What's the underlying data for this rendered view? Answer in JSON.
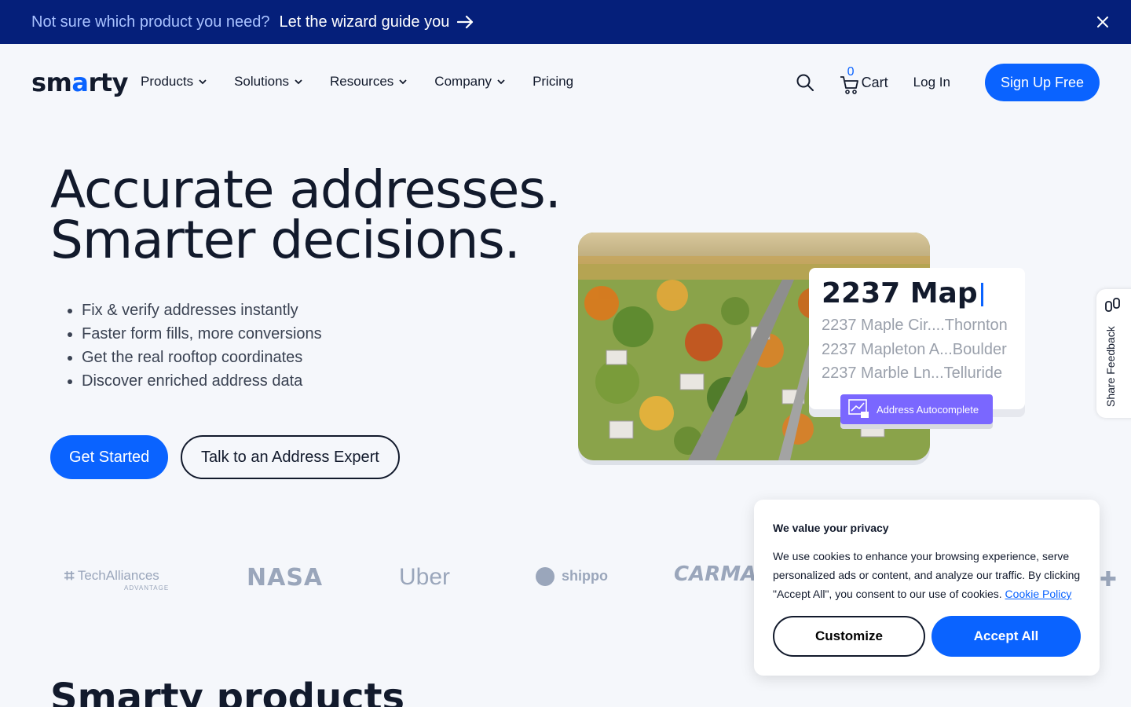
{
  "banner": {
    "muted_text": "Not sure which product you need?",
    "link_text": "Let the wizard guide you",
    "arrow_icon": "arrow-right-icon",
    "close_icon": "close-icon",
    "bg_color": "#051f7a"
  },
  "nav": {
    "logo_text": "smarty",
    "items": [
      {
        "label": "Products",
        "has_dropdown": true
      },
      {
        "label": "Solutions",
        "has_dropdown": true
      },
      {
        "label": "Resources",
        "has_dropdown": true
      },
      {
        "label": "Company",
        "has_dropdown": true
      },
      {
        "label": "Pricing",
        "has_dropdown": false
      }
    ],
    "search_icon": "search-icon",
    "cart_count": "0",
    "cart_label": "Cart",
    "login_label": "Log In",
    "signup_label": "Sign Up Free",
    "accent_color": "#0a63ff"
  },
  "hero": {
    "title_line1": "Accurate addresses.",
    "title_line2": "Smarter decisions.",
    "bullets": [
      "Fix & verify addresses instantly",
      "Faster form fills, more conversions",
      "Get the real rooftop coordinates",
      "Discover enriched address data"
    ],
    "primary_cta": "Get Started",
    "secondary_cta": "Talk to an Address Expert"
  },
  "autocomplete_demo": {
    "query": "2237 Map",
    "suggestions": [
      "2237 Maple Cir....Thornton",
      "2237 Mapleton A...Boulder",
      "2237 Marble Ln...Telluride"
    ],
    "badge_label": "Address Autocomplete"
  },
  "feedback_tab": {
    "label": "Share Feedback"
  },
  "logos": [
    "TechAlliances",
    "ADVANTAGE",
    "NASA",
    "Uber",
    "shippo",
    "CARMAX"
  ],
  "section": {
    "title": "Smarty products"
  },
  "cookie": {
    "heading": "We value your privacy",
    "body": "We use cookies to enhance your browsing experience, serve personalized ads or content, and analyze our traffic. By clicking \"Accept All\", you consent to our use of cookies.",
    "policy_link": "Cookie Policy",
    "customize_label": "Customize",
    "accept_label": "Accept All"
  }
}
